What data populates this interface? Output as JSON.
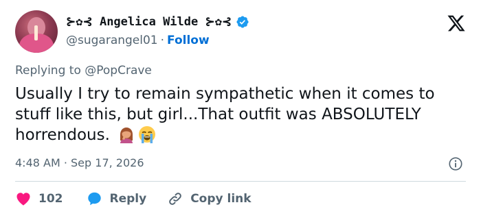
{
  "author": {
    "display_name": "⊱✿⊰ Angelica Wilde ⊱✿⊰",
    "handle": "@sugarangel01",
    "separator": "·",
    "follow_label": "Follow",
    "avatar_icon": "profile-photo"
  },
  "tweet": {
    "replying_to": "Replying to @PopCrave",
    "text": "Usually I try to remain sympathetic when it comes to stuff like this, but girl...That outfit was ABSOLUTELY horrendous.",
    "emojis": [
      "woman-facepalming-emoji",
      "loudly-crying-face-emoji"
    ],
    "timestamp": "4:48 AM · Sep 17, 2026"
  },
  "actions": {
    "like_count": "102",
    "reply_label": "Reply",
    "copy_link_label": "Copy link"
  },
  "colors": {
    "text": "#0f1419",
    "muted": "#536471",
    "link": "#006fd6",
    "like": "#f91880",
    "reply": "#1d9bf0",
    "verified": "#1d9bf0"
  }
}
